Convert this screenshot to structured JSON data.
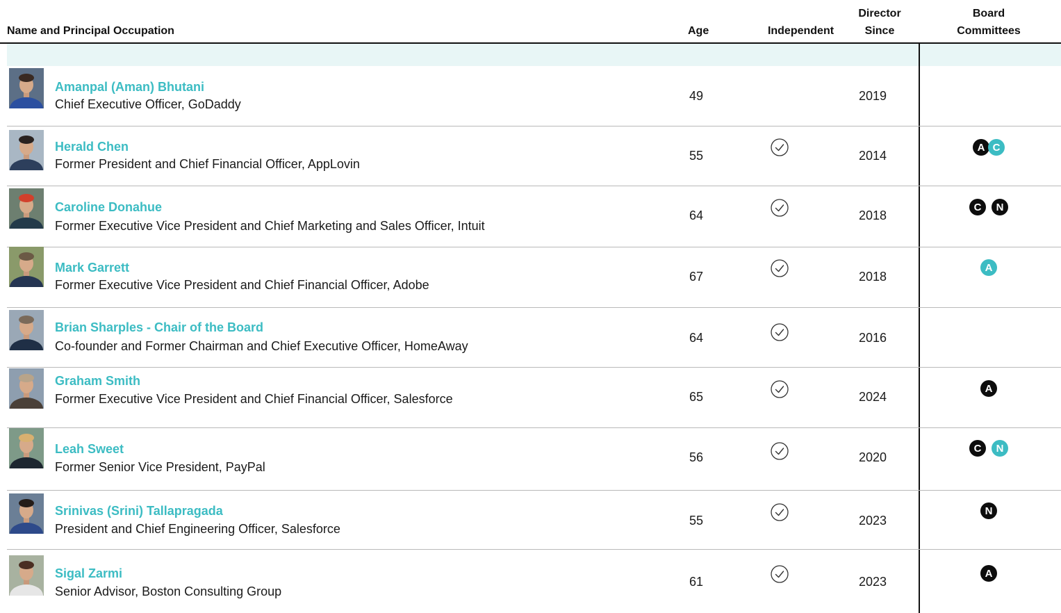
{
  "headers": {
    "name": "Name and Principal Occupation",
    "age": "Age",
    "independent": "Independent",
    "director_since_line1": "Director",
    "director_since_line2": "Since",
    "committees_line1": "Board",
    "committees_line2": "Committees"
  },
  "colors": {
    "accent": "#3cbcc3",
    "band": "#e8f6f6",
    "dark_badge": "#0d0d0d"
  },
  "directors": [
    {
      "name": "Amanpal (Aman) Bhutani",
      "occupation": "Chief Executive Officer, GoDaddy",
      "age": "49",
      "independent": false,
      "since": "2019",
      "committees": []
    },
    {
      "name": "Herald Chen",
      "occupation": "Former President and Chief Financial Officer, AppLovin",
      "age": "55",
      "independent": true,
      "since": "2014",
      "committees": [
        {
          "letter": "A",
          "style": "black"
        },
        {
          "letter": "C",
          "style": "teal"
        }
      ]
    },
    {
      "name": "Caroline Donahue",
      "occupation": "Former Executive Vice President and Chief Marketing and Sales Officer, Intuit",
      "age": "64",
      "independent": true,
      "since": "2018",
      "committees": [
        {
          "letter": "C",
          "style": "black"
        },
        {
          "letter": "N",
          "style": "black"
        }
      ]
    },
    {
      "name": "Mark Garrett",
      "occupation": "Former Executive Vice President and Chief Financial Officer, Adobe",
      "age": "67",
      "independent": true,
      "since": "2018",
      "committees": [
        {
          "letter": "A",
          "style": "teal"
        }
      ]
    },
    {
      "name": "Brian Sharples - Chair of the Board",
      "occupation": "Co-founder and Former Chairman and Chief Executive Officer, HomeAway",
      "age": "64",
      "independent": true,
      "since": "2016",
      "committees": []
    },
    {
      "name": "Graham Smith",
      "occupation": "Former Executive Vice President and Chief Financial Officer, Salesforce",
      "age": "65",
      "independent": true,
      "since": "2024",
      "committees": [
        {
          "letter": "A",
          "style": "black"
        }
      ]
    },
    {
      "name": "Leah Sweet",
      "occupation": "Former Senior Vice President, PayPal",
      "age": "56",
      "independent": true,
      "since": "2020",
      "committees": [
        {
          "letter": "C",
          "style": "black"
        },
        {
          "letter": "N",
          "style": "teal"
        }
      ]
    },
    {
      "name": "Srinivas (Srini) Tallapragada",
      "occupation": "President and Chief Engineering Officer, Salesforce",
      "age": "55",
      "independent": true,
      "since": "2023",
      "committees": [
        {
          "letter": "N",
          "style": "black"
        }
      ]
    },
    {
      "name": "Sigal Zarmi",
      "occupation": "Senior Advisor, Boston Consulting Group",
      "age": "61",
      "independent": true,
      "since": "2023",
      "committees": [
        {
          "letter": "A",
          "style": "black"
        }
      ]
    }
  ]
}
